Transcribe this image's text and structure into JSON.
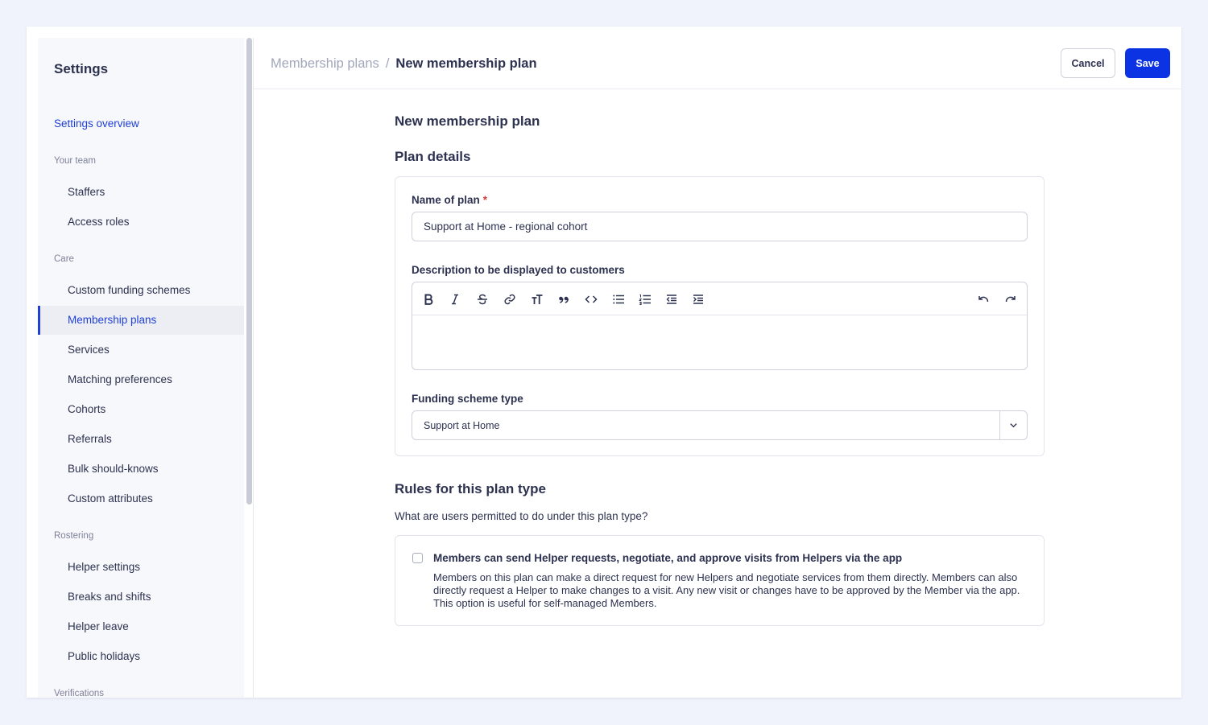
{
  "sidebar": {
    "title": "Settings",
    "overview_link": "Settings overview",
    "groups": {
      "team": "Your team",
      "care": "Care",
      "rostering": "Rostering",
      "verifications": "Verifications"
    },
    "team_items": [
      "Staffers",
      "Access roles"
    ],
    "care_items": [
      "Custom funding schemes",
      "Membership plans",
      "Services",
      "Matching preferences",
      "Cohorts",
      "Referrals",
      "Bulk should-knows",
      "Custom attributes"
    ],
    "rostering_items": [
      "Helper settings",
      "Breaks and shifts",
      "Helper leave",
      "Public holidays"
    ],
    "active_item": "Membership plans"
  },
  "header": {
    "breadcrumb_parent": "Membership plans",
    "breadcrumb_separator": "/",
    "breadcrumb_current": "New membership plan",
    "cancel_label": "Cancel",
    "save_label": "Save",
    "save_color": "#0b33e3"
  },
  "form": {
    "title": "New membership plan",
    "plan_details_heading": "Plan details",
    "name_label": "Name of plan",
    "name_required_marker": "*",
    "name_value": "Support at Home - regional cohort",
    "description_label": "Description to be displayed to customers",
    "description_value": "",
    "toolbar_icons": [
      "bold-icon",
      "italic-icon",
      "strikethrough-icon",
      "link-icon",
      "text-size-icon",
      "quote-icon",
      "code-icon",
      "bullet-list-icon",
      "numbered-list-icon",
      "outdent-icon",
      "indent-icon",
      "undo-icon",
      "redo-icon"
    ],
    "funding_label": "Funding scheme type",
    "funding_value": "Support at Home"
  },
  "rules": {
    "heading": "Rules for this plan type",
    "subheading": "What are users permitted to do under this plan type?",
    "option_title": "Members can send Helper requests, negotiate, and approve visits from Helpers via the app",
    "option_description": "Members on this plan can make a direct request for new Helpers and negotiate services from them directly. Members can also directly request a Helper to make changes to a visit. Any new visit or changes have to be approved by the Member via the app. This option is useful for self-managed Members.",
    "option_checked": false
  }
}
